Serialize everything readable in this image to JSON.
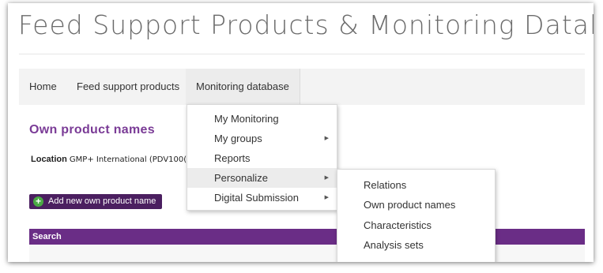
{
  "site": {
    "title": "Feed Support Products & Monitoring Database"
  },
  "nav": {
    "items": [
      {
        "label": "Home"
      },
      {
        "label": "Feed support products"
      },
      {
        "label": "Monitoring database"
      }
    ]
  },
  "page": {
    "heading": "Own product names",
    "location_label": "Location",
    "location_value": "GMP+ International (PDV100(",
    "add_button": "Add new own product name",
    "search_label": "Search"
  },
  "menu": {
    "items": [
      {
        "label": "My Monitoring",
        "has_submenu": false
      },
      {
        "label": "My groups",
        "has_submenu": true
      },
      {
        "label": "Reports",
        "has_submenu": false
      },
      {
        "label": "Personalize",
        "has_submenu": true,
        "highlighted": true
      },
      {
        "label": "Digital Submission",
        "has_submenu": true
      }
    ]
  },
  "submenu": {
    "items": [
      {
        "label": "Relations"
      },
      {
        "label": "Own product names"
      },
      {
        "label": "Characteristics"
      },
      {
        "label": "Analysis sets"
      }
    ]
  },
  "icons": {
    "submenu_arrow": "triangle-right-icon",
    "add": "plus-circle-icon"
  },
  "colors": {
    "accent": "#7a3b96",
    "button": "#4b1f60",
    "search_bar": "#6a2d86",
    "plus": "#4aa844"
  }
}
